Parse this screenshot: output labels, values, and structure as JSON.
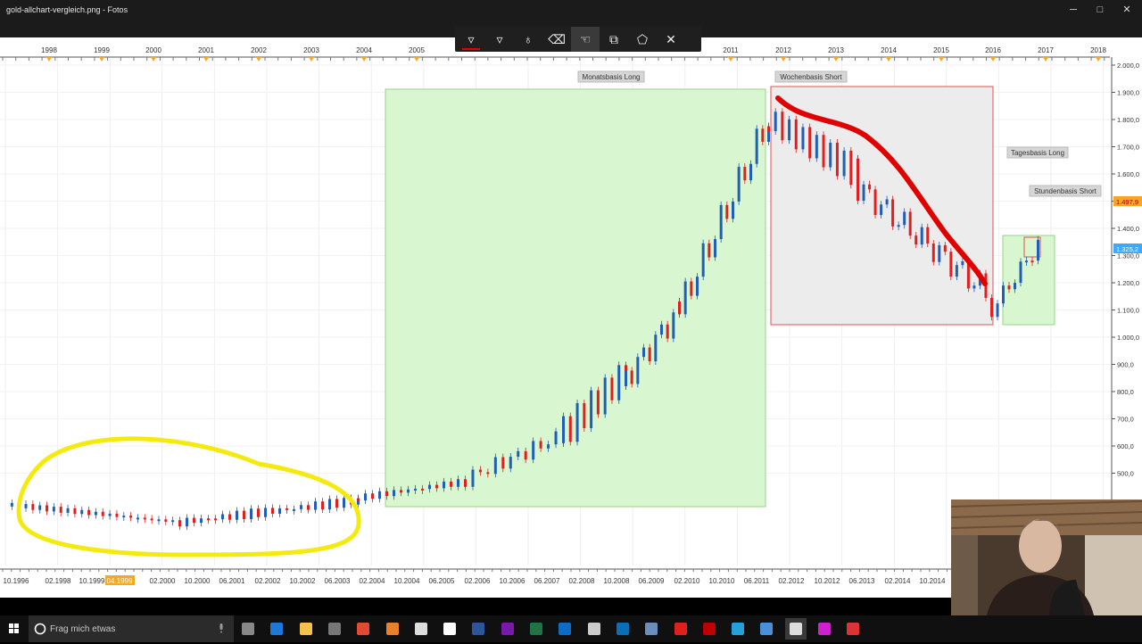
{
  "window": {
    "title": "gold-allchart-vergleich.png - Fotos",
    "minimize": "─",
    "maximize": "□",
    "close": "✕"
  },
  "toolbar": {
    "tools": [
      {
        "icon": "ballpoint-pen-icon",
        "glyph": "▿"
      },
      {
        "icon": "pencil-icon",
        "glyph": "▿"
      },
      {
        "icon": "highlighter-icon",
        "glyph": "♁"
      },
      {
        "icon": "eraser-icon",
        "glyph": "⌫"
      },
      {
        "icon": "touch-write-icon",
        "glyph": "☜"
      },
      {
        "icon": "copy-icon",
        "glyph": "⧉"
      },
      {
        "icon": "crop-icon",
        "glyph": "⬠"
      },
      {
        "icon": "close-icon",
        "glyph": "✕"
      }
    ]
  },
  "chart": {
    "top_year_labels": [
      "1998",
      "1999",
      "2000",
      "2001",
      "2002",
      "2003",
      "2004",
      "2005",
      "2011",
      "2012",
      "2013",
      "2014",
      "2015",
      "2016",
      "2017",
      "2018"
    ],
    "bottom_date_labels": [
      "10.1996",
      "02.1998",
      "10.1999",
      "02.2000",
      "10.2000",
      "06.2001",
      "02.2002",
      "10.2002",
      "06.2003",
      "02.2004",
      "10.2004",
      "06.2005",
      "02.2006",
      "10.2006",
      "06.2007",
      "02.2008",
      "10.2008",
      "06.2009",
      "02.2010",
      "10.2010",
      "06.2011",
      "02.2012",
      "10.2012",
      "06.2013",
      "02.2014",
      "10.2014"
    ],
    "bottom_highlight": "04.1999",
    "price_labels": [
      "2.000,0",
      "1.900,0",
      "1.800,0",
      "1.700,0",
      "1.600,0",
      "1.500,0",
      "1.400,0",
      "1.300,0",
      "1.200,0",
      "1.100,0",
      "1.000,0",
      "900,0",
      "800,0",
      "700,0",
      "600,0",
      "500,0"
    ],
    "current_price": "1.497,9",
    "marked_price": "1.325,2",
    "labels": {
      "monthly": "Monatsbasis Long",
      "weekly": "Wochenbasis Short",
      "daily": "Tagesbasis Long",
      "hourly": "Stundenbasis Short"
    },
    "colors": {
      "up": "#1f5fb8",
      "down": "#e02020",
      "long_zone": "#d8f7d0",
      "short_zone": "#ececec",
      "annotation_yellow": "#f5ea10",
      "annotation_red": "#e00000",
      "price_tag": "#f5a623",
      "price_tag_blue": "#3fa9f5"
    }
  },
  "taskbar": {
    "search_placeholder": "Frag mich etwas",
    "apps": [
      "task-view-icon",
      "edge-icon",
      "file-explorer-icon",
      "store-icon",
      "chrome-icon",
      "firefox-icon",
      "notepad-icon",
      "home-icon",
      "word-icon",
      "onenote-icon",
      "excel-icon",
      "teamviewer-icon",
      "settings-icon",
      "remote-desktop-icon",
      "virtualbox-icon",
      "opera-icon",
      "filezilla-icon",
      "photoshop-icon",
      "app-icon",
      "photos-icon",
      "app-icon-2",
      "app-icon-3"
    ]
  }
}
